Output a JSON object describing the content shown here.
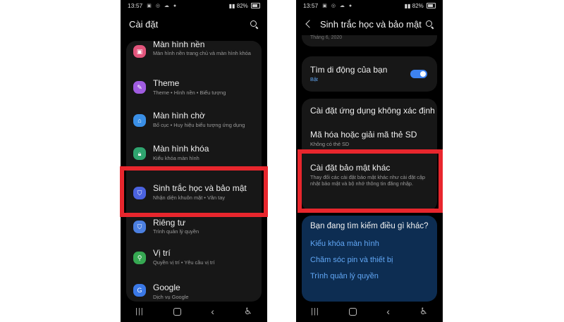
{
  "status_bar": {
    "time": "13:57",
    "battery": "82%"
  },
  "left_screen": {
    "title": "Cài đặt",
    "items": [
      {
        "label": "Màn hình nền",
        "sub": "Màn hình nền trang chủ và màn hình khóa",
        "icon": "wallpaper-icon",
        "color": "#e2557c"
      },
      {
        "label": "Theme",
        "sub": "Theme • Hình nền • Biểu tượng",
        "icon": "theme-icon",
        "color": "#a05ce0"
      },
      {
        "label": "Màn hình chờ",
        "sub": "Bố cục • Huy hiệu biểu tượng ứng dụng",
        "icon": "home-screen-icon",
        "color": "#3a8fe6"
      },
      {
        "label": "Màn hình khóa",
        "sub": "Kiểu khóa màn hình",
        "icon": "lock-icon",
        "color": "#2fa46f"
      },
      {
        "label": "Sinh trắc học và bảo mật",
        "sub": "Nhận diện khuôn mặt • Vân tay",
        "icon": "shield-icon",
        "color": "#4b63e0"
      },
      {
        "label": "Riêng tư",
        "sub": "Trình quản lý quyền",
        "icon": "privacy-icon",
        "color": "#4b7fe0"
      },
      {
        "label": "Vị trí",
        "sub": "Quyền vị trí • Yêu cầu vị trí",
        "icon": "location-icon",
        "color": "#36a852"
      },
      {
        "label": "Google",
        "sub": "Dịch vụ Google",
        "icon": "google-icon",
        "color": "#3a78e6"
      }
    ]
  },
  "right_screen": {
    "title": "Sinh trắc học và bảo mật",
    "top_cut_text": "Tháng 6, 2020",
    "find_device": {
      "label": "Tìm di động của bạn",
      "sub": "Bật"
    },
    "items": [
      {
        "label": "Cài đặt ứng dụng không xác định",
        "sub": ""
      },
      {
        "label": "Mã hóa hoặc giải mã thẻ SD",
        "sub": "Không có thẻ SD"
      },
      {
        "label": "Cài đặt bảo mật khác",
        "sub": "Thay đổi các cài đặt bảo mật khác như cài đặt cập nhật bảo mật và bộ nhớ thông tin đăng nhập."
      }
    ],
    "suggestions": {
      "title": "Bạn đang tìm kiếm điều gì khác?",
      "links": [
        "Kiểu khóa màn hình",
        "Chăm sóc pin và thiết bị",
        "Trình quản lý quyền"
      ]
    }
  },
  "colors": {
    "highlight": "#e8262d",
    "accent": "#3d82f0",
    "link": "#61a7f5"
  }
}
